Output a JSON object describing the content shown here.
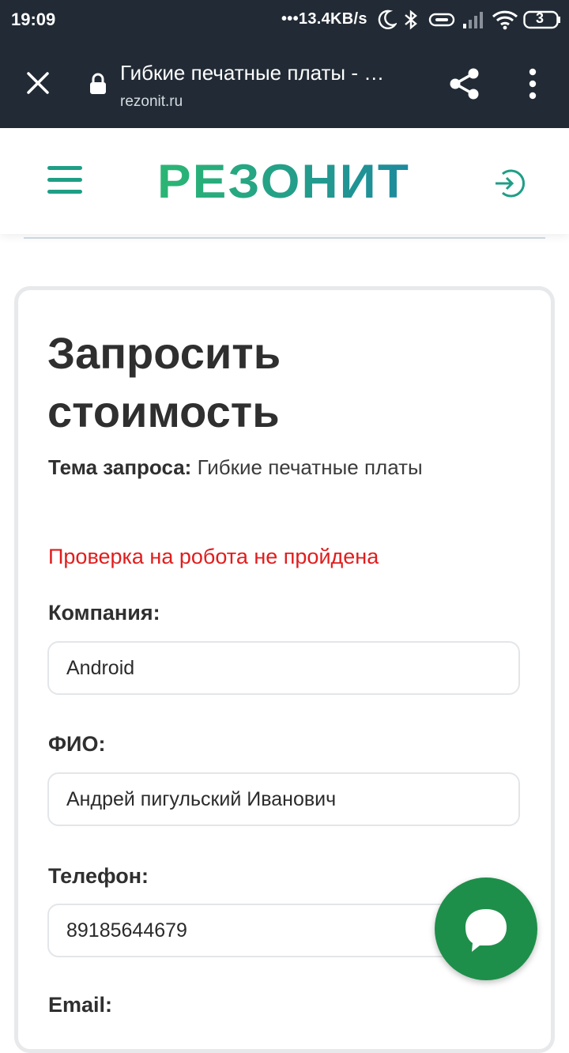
{
  "status_bar": {
    "time": "19:09",
    "network_speed": "13.4KB/s",
    "battery_level": "3",
    "icons": [
      "moon-icon",
      "bluetooth-icon",
      "link-icon",
      "signal-icon",
      "wifi-icon",
      "battery-icon"
    ]
  },
  "browser": {
    "page_title": "Гибкие печатные платы - …",
    "url": "rezonit.ru",
    "icons": [
      "close-icon",
      "lock-icon",
      "share-icon",
      "more-vertical-icon"
    ]
  },
  "site": {
    "logo_text": "РЕЗОНИТ",
    "icons": [
      "menu-icon",
      "login-icon"
    ],
    "accent_color": "#1f9e86",
    "logo_gradient": [
      "#2bb673",
      "#1d8a9e"
    ]
  },
  "form": {
    "title": "Запросить стоимость",
    "subject_label": "Тема запроса:",
    "subject_value": "Гибкие печатные платы",
    "error_text": "Проверка на робота не пройдена",
    "error_color": "#e11d1d",
    "fields": [
      {
        "label": "Компания:",
        "value": "Android"
      },
      {
        "label": "ФИО:",
        "value": "Андрей пигульский Иванович"
      },
      {
        "label": "Телефон:",
        "value": "89185644679"
      },
      {
        "label": "Email:",
        "value": ""
      }
    ]
  },
  "chat_button": {
    "icon": "chat-bubble-icon",
    "color": "#1e8f4a"
  }
}
